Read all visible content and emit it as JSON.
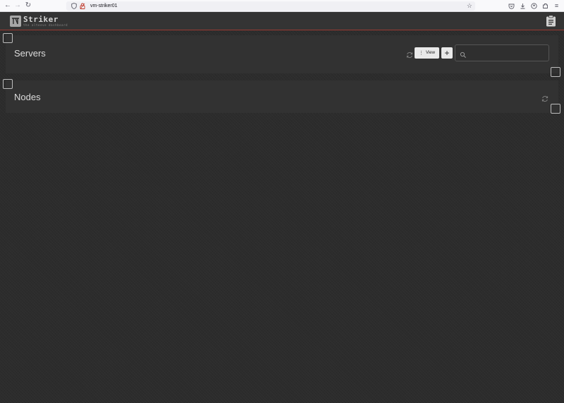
{
  "browser": {
    "url": "vm-striker01",
    "back_icon": "back-arrow-icon",
    "forward_icon": "forward-arrow-icon",
    "reload_icon": "reload-icon"
  },
  "app": {
    "brand_name": "Striker",
    "brand_subtitle": "the alteeve dashboard",
    "accent_color": "#9a3a32"
  },
  "servers": {
    "title": "Servers",
    "view_label": "View",
    "add_label": "+",
    "search_placeholder": ""
  },
  "nodes": {
    "title": "Nodes"
  }
}
